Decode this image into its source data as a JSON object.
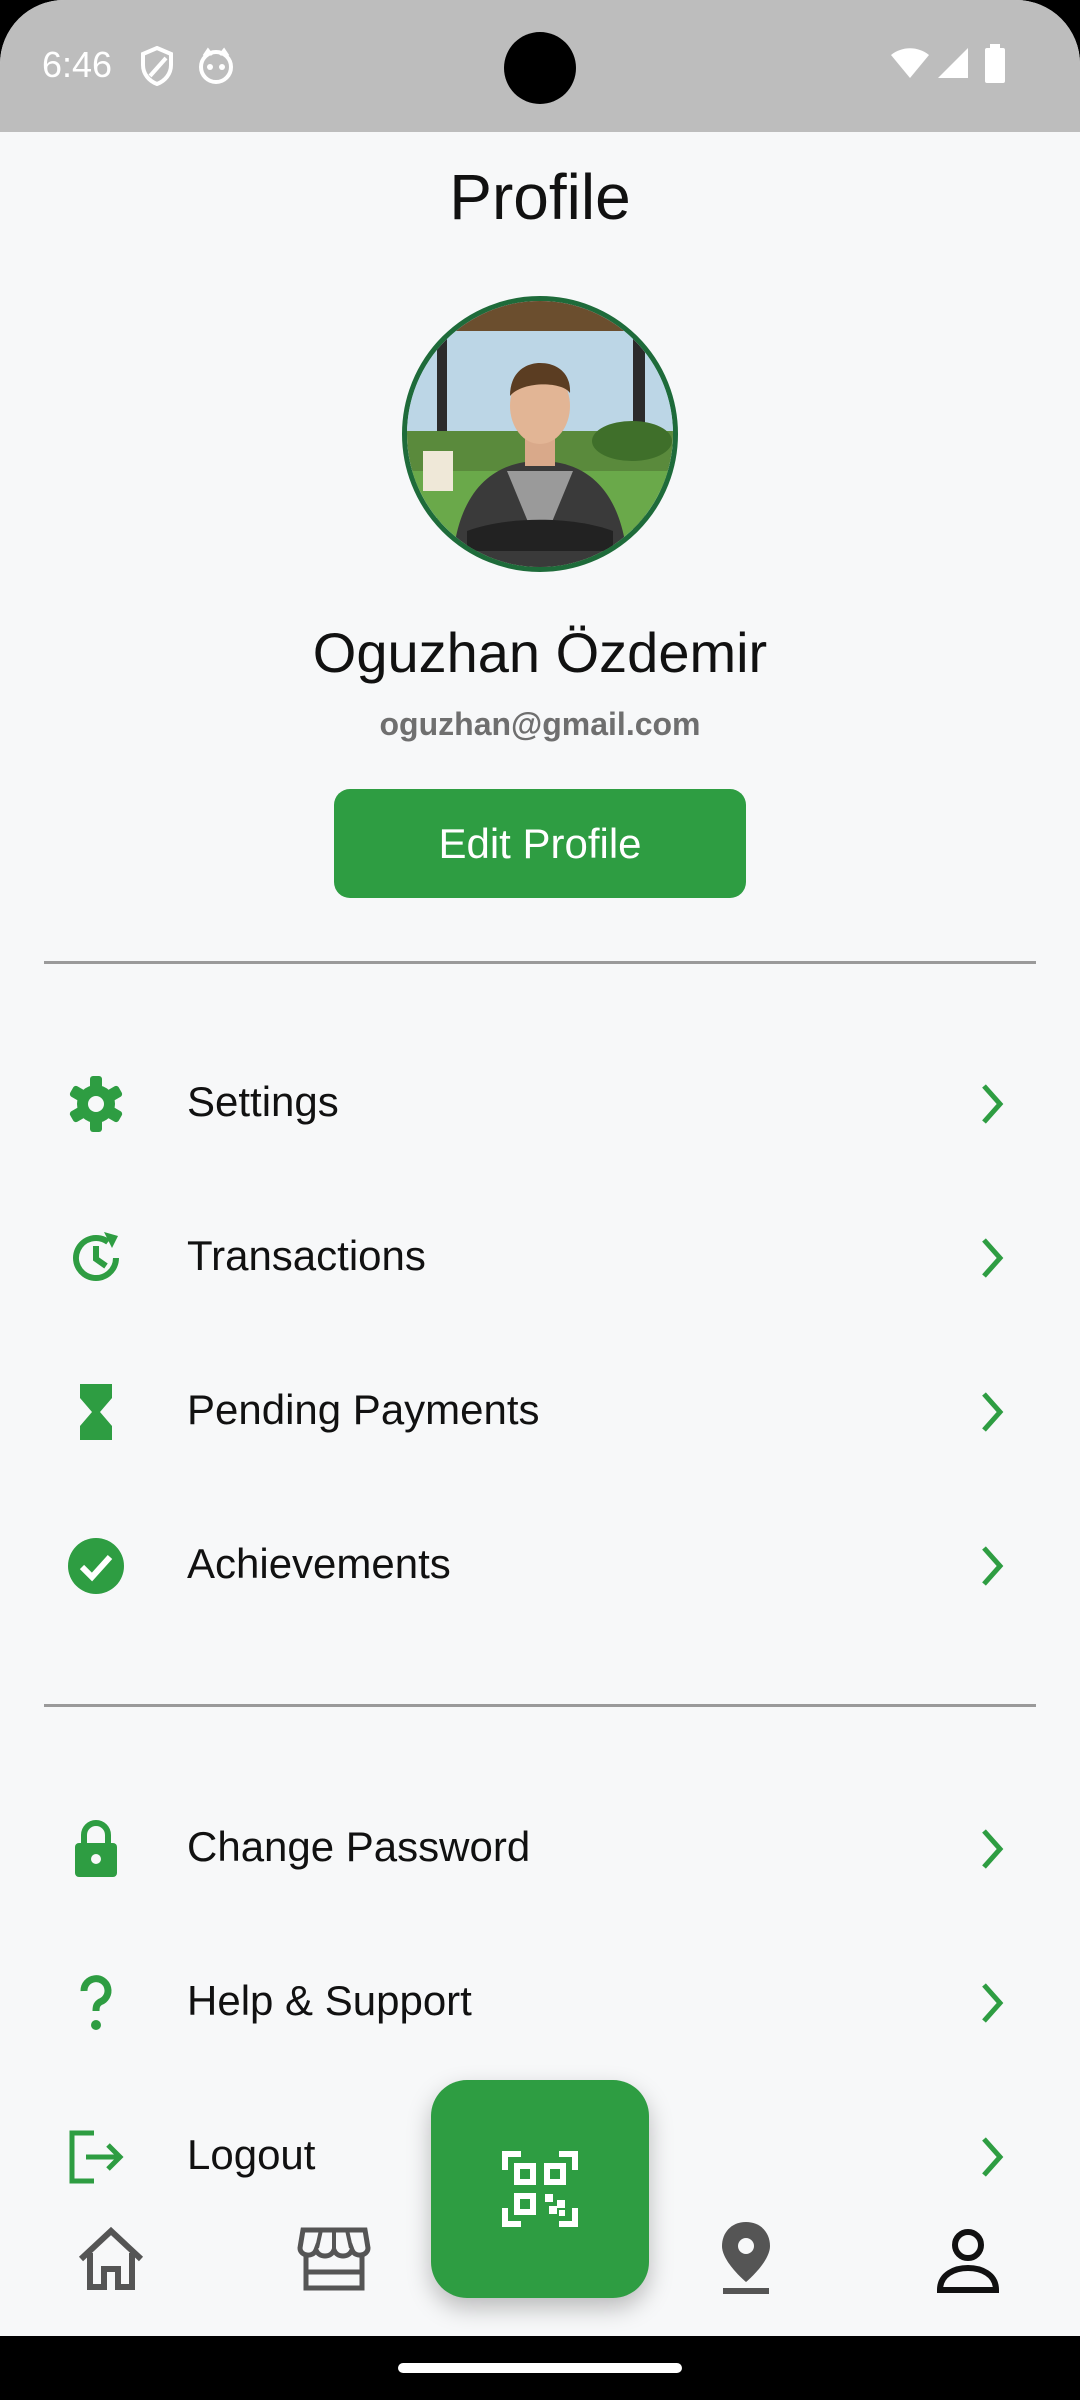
{
  "status_bar": {
    "time": "6:46"
  },
  "page": {
    "title": "Profile"
  },
  "user": {
    "name": "Oguzhan Özdemir",
    "email": "oguzhan@gmail.com"
  },
  "edit_button_label": "Edit Profile",
  "menu_primary": [
    {
      "label": "Settings",
      "icon": "gear-icon"
    },
    {
      "label": "Transactions",
      "icon": "history-icon"
    },
    {
      "label": "Pending Payments",
      "icon": "hourglass-icon"
    },
    {
      "label": "Achievements",
      "icon": "check-circle-icon"
    }
  ],
  "menu_secondary": [
    {
      "label": "Change Password",
      "icon": "lock-icon"
    },
    {
      "label": "Help & Support",
      "icon": "question-icon"
    },
    {
      "label": "Logout",
      "icon": "logout-icon"
    }
  ],
  "bottom_nav": [
    {
      "name": "home",
      "icon": "home-icon"
    },
    {
      "name": "store",
      "icon": "store-icon"
    },
    {
      "name": "scan",
      "icon": "qr-code-icon"
    },
    {
      "name": "location",
      "icon": "location-pin-icon"
    },
    {
      "name": "profile",
      "icon": "person-icon",
      "active": true
    }
  ],
  "colors": {
    "accent": "#2e9d42",
    "avatar_border": "#1e6b3a",
    "background": "#f7f8f9",
    "status_bar": "#bdbdbd"
  }
}
